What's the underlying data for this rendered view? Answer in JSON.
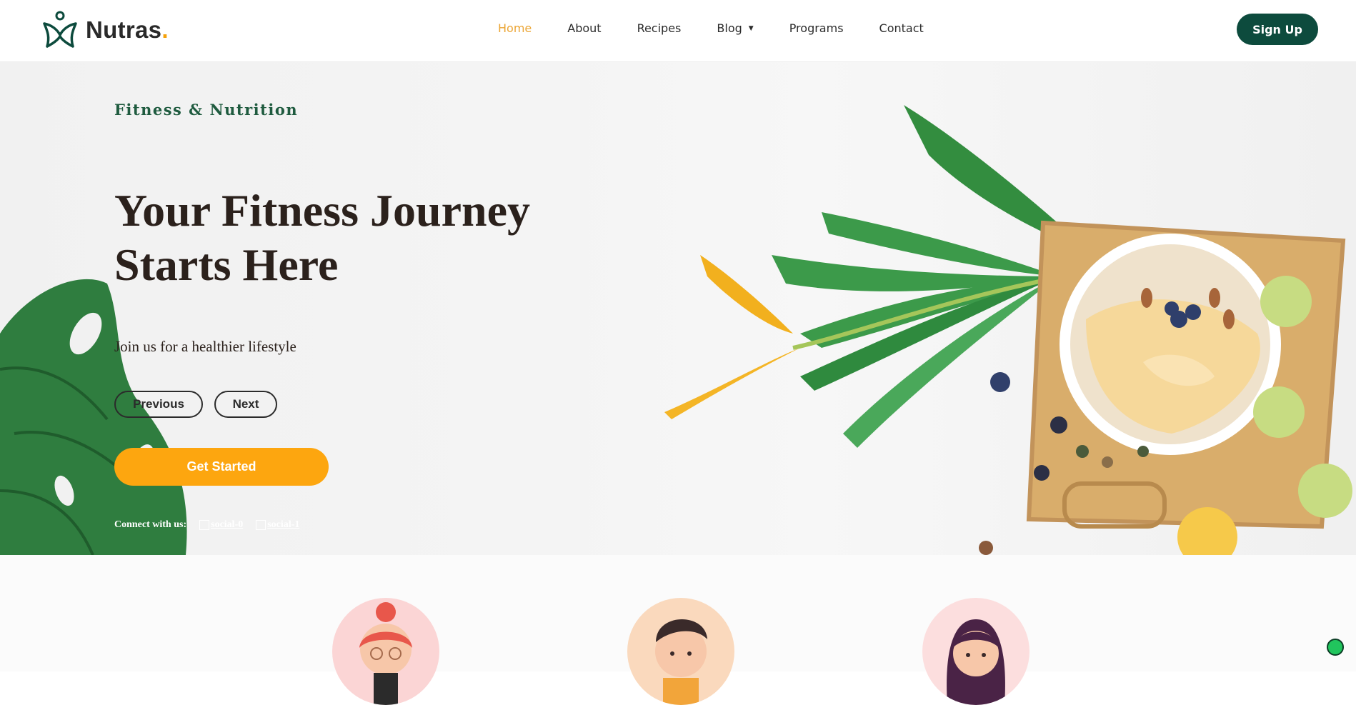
{
  "brand": {
    "name": "Nutras",
    "dot": ".",
    "colors": {
      "primary": "#0d4b3d",
      "accent": "#fda60f",
      "green": "#1f5b3f"
    }
  },
  "nav": {
    "items": [
      {
        "label": "Home",
        "active": true
      },
      {
        "label": "About"
      },
      {
        "label": "Recipes"
      },
      {
        "label": "Blog",
        "caret": "▼"
      },
      {
        "label": "Programs"
      },
      {
        "label": "Contact"
      }
    ],
    "signup": "Sign Up"
  },
  "hero": {
    "eyebrow": "Fitness & Nutrition",
    "headline": "Your Fitness Journey Starts Here",
    "subtitle": "Join us for a healthier lifestyle",
    "prev": "Previous",
    "next": "Next",
    "cta": "Get Started",
    "connect": "Connect with us:",
    "social": [
      "social-0",
      "social-1"
    ]
  },
  "avatars": [
    "woman-avatar-icon",
    "man-avatar-icon",
    "woman-dark-hair-avatar-icon"
  ]
}
